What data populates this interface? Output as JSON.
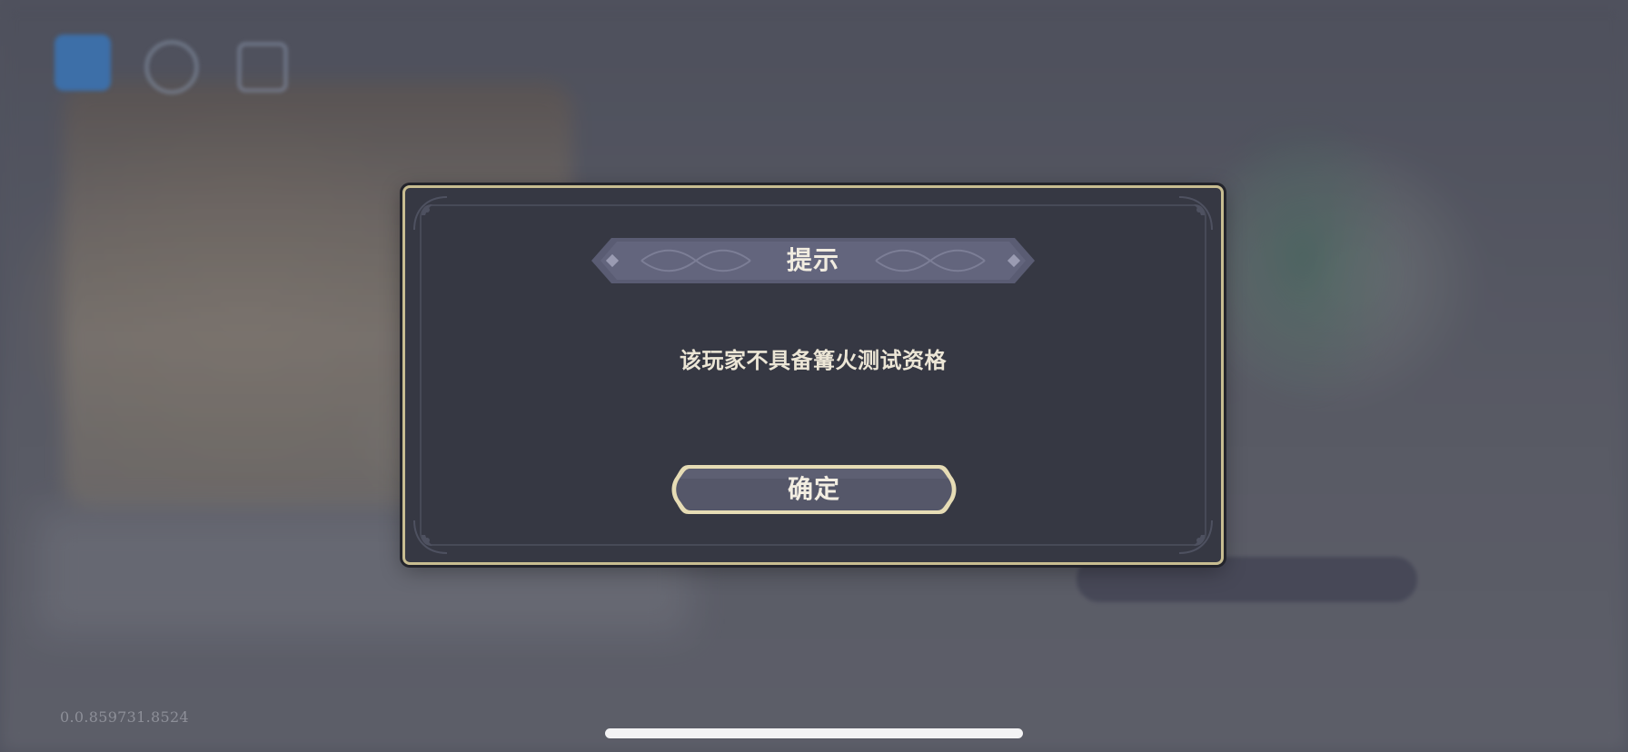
{
  "background": {
    "version_text": "0.0.859731.8524"
  },
  "dialog": {
    "title": "提示",
    "message": "该玩家不具备篝火测试资格",
    "confirm_label": "确定"
  },
  "colors": {
    "dialog_bg": "#363843",
    "dialog_border": "#c8bd91",
    "banner_bg": "#5a5c73",
    "button_bg": "#555769",
    "text": "#f1ece0"
  }
}
